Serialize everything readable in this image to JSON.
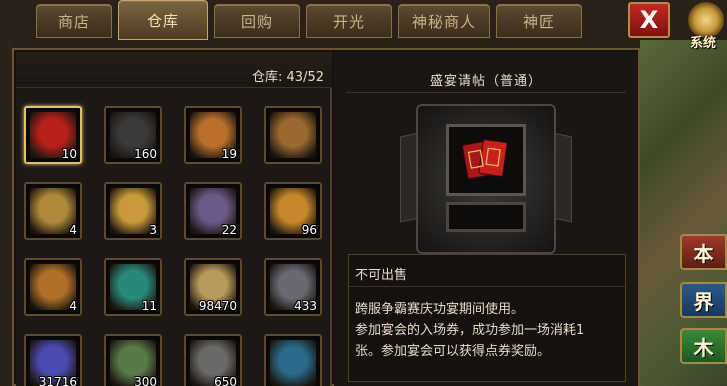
{
  "tabs": [
    {
      "label": "商店",
      "active": false
    },
    {
      "label": "仓库",
      "active": true
    },
    {
      "label": "回购",
      "active": false
    },
    {
      "label": "开光",
      "active": false
    },
    {
      "label": "神秘商人",
      "active": false
    },
    {
      "label": "神匠",
      "active": false
    }
  ],
  "close_label": "X",
  "system_label": "系统",
  "warehouse": {
    "label": "仓库:",
    "count": "43/52"
  },
  "items": [
    {
      "qty": "10",
      "icon": "red-invitation-icon",
      "color": "#b8201c",
      "selected": true
    },
    {
      "qty": "160",
      "icon": "coal-ore-icon",
      "color": "#3a3a3a"
    },
    {
      "qty": "19",
      "icon": "golden-dragon-token-icon",
      "color": "#b8702a"
    },
    {
      "qty": "",
      "icon": "golden-dragon-token-icon",
      "color": "#9a6a30"
    },
    {
      "qty": "4",
      "icon": "purple-gold-seal-icon",
      "color": "#b08a3a"
    },
    {
      "qty": "3",
      "icon": "gold-seal-icon",
      "color": "#c89a3a"
    },
    {
      "qty": "22",
      "icon": "purple-crystal-ore-icon",
      "color": "#6a5a8a"
    },
    {
      "qty": "96",
      "icon": "gold-shang-seal-icon",
      "color": "#c8882a"
    },
    {
      "qty": "4",
      "icon": "gold-hu-seal-icon",
      "color": "#b0702a"
    },
    {
      "qty": "11",
      "icon": "jade-disc-icon",
      "color": "#2a8a7a"
    },
    {
      "qty": "98470",
      "icon": "scroll-icon",
      "color": "#b89a5a"
    },
    {
      "qty": "433",
      "icon": "iron-ore-icon",
      "color": "#6a6a72"
    },
    {
      "qty": "31716",
      "icon": "blue-ticket-icon",
      "color": "#4a4ab0"
    },
    {
      "qty": "300",
      "icon": "green-ingot-icon",
      "color": "#5a7a4a"
    },
    {
      "qty": "650",
      "icon": "gray-ingot-icon",
      "color": "#6a6a6a"
    },
    {
      "qty": "",
      "icon": "golden-dragon-ring-icon",
      "color": "#2a6a8a"
    }
  ],
  "detail": {
    "title": "盛宴请帖（普通）",
    "icon": "red-invitation-icon",
    "tradable": "不可出售",
    "description": [
      "跨服争霸赛庆功宴期间使用。",
      "参加宴会的入场券，成功参加一场消耗1",
      "张。参加宴会可以获得点券奖励。"
    ]
  },
  "side_buttons": [
    "本",
    "界",
    "木"
  ],
  "colors": {
    "accent_gold": "#c9a565",
    "close_red": "#c42820"
  }
}
